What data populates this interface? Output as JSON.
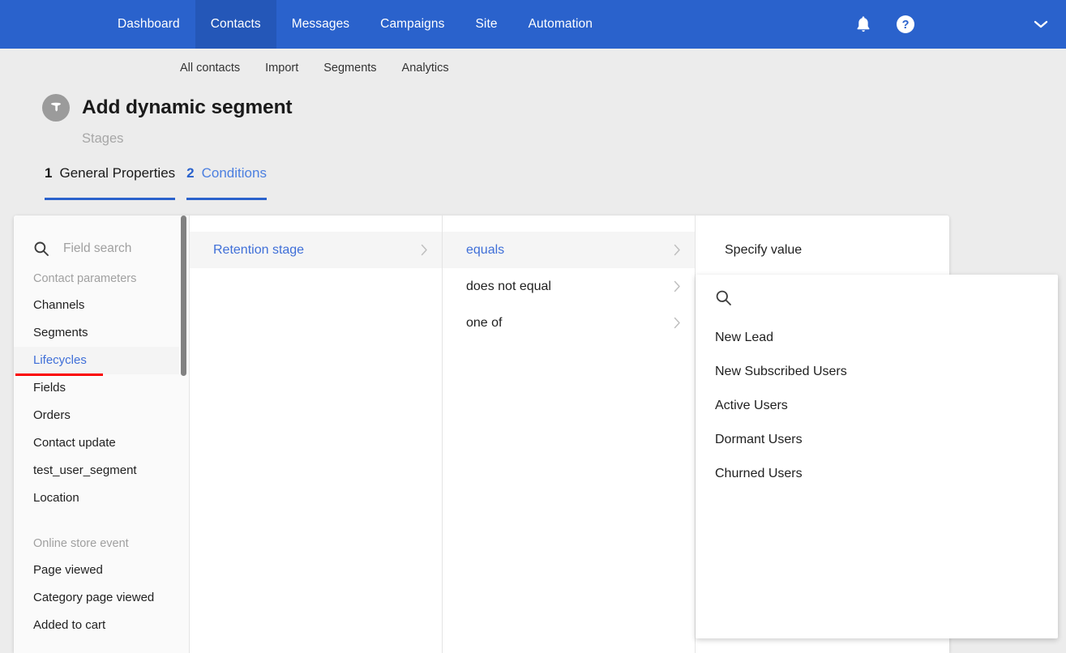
{
  "topnav": {
    "items": [
      {
        "label": "Dashboard",
        "active": false
      },
      {
        "label": "Contacts",
        "active": true
      },
      {
        "label": "Messages",
        "active": false
      },
      {
        "label": "Campaigns",
        "active": false
      },
      {
        "label": "Site",
        "active": false
      },
      {
        "label": "Automation",
        "active": false
      }
    ],
    "icons": [
      "bell-icon",
      "help-icon",
      "chevron-down-icon"
    ],
    "brand_color": "#2a62cc",
    "active_color": "#2457b8"
  },
  "subnav": {
    "items": [
      {
        "label": "All contacts"
      },
      {
        "label": "Import"
      },
      {
        "label": "Segments"
      },
      {
        "label": "Analytics"
      }
    ]
  },
  "header": {
    "icon": "filter-funnel-icon",
    "title": "Add dynamic segment",
    "subtitle": "Stages"
  },
  "steps": [
    {
      "num": "1",
      "label": "General Properties",
      "active": false
    },
    {
      "num": "2",
      "label": "Conditions",
      "active": true
    }
  ],
  "builder": {
    "field_search": {
      "icon": "search-icon",
      "placeholder": "Field search",
      "value": ""
    },
    "groups": [
      {
        "label": "Contact parameters",
        "items": [
          {
            "label": "Channels",
            "selected": false
          },
          {
            "label": "Segments",
            "selected": false
          },
          {
            "label": "Lifecycles",
            "selected": true
          },
          {
            "label": "Fields",
            "selected": false
          },
          {
            "label": "Orders",
            "selected": false
          },
          {
            "label": "Contact update",
            "selected": false
          },
          {
            "label": "test_user_segment",
            "selected": false
          },
          {
            "label": "Location",
            "selected": false
          }
        ]
      },
      {
        "label": "Online store event",
        "items": [
          {
            "label": "Page viewed",
            "selected": false
          },
          {
            "label": "Category page viewed",
            "selected": false
          },
          {
            "label": "Added to cart",
            "selected": false
          }
        ]
      }
    ],
    "annotation": {
      "type": "red-underline",
      "target": "Lifecycles",
      "color": "#fa0000"
    },
    "parameters": [
      {
        "label": "Retention stage",
        "selected": true,
        "chevron": "chevron-right-icon"
      }
    ],
    "operators": [
      {
        "label": "equals",
        "selected": true,
        "chevron": "chevron-right-icon"
      },
      {
        "label": "does not equal",
        "selected": false,
        "chevron": "chevron-right-icon"
      },
      {
        "label": "one of",
        "selected": false,
        "chevron": "chevron-right-icon"
      }
    ],
    "value_column": {
      "heading": "Specify value"
    },
    "value_dropdown": {
      "search_icon": "search-icon",
      "search_value": "",
      "options": [
        {
          "label": "New Lead"
        },
        {
          "label": "New Subscribed Users"
        },
        {
          "label": "Active Users"
        },
        {
          "label": "Dormant Users"
        },
        {
          "label": "Churned Users"
        }
      ]
    }
  }
}
